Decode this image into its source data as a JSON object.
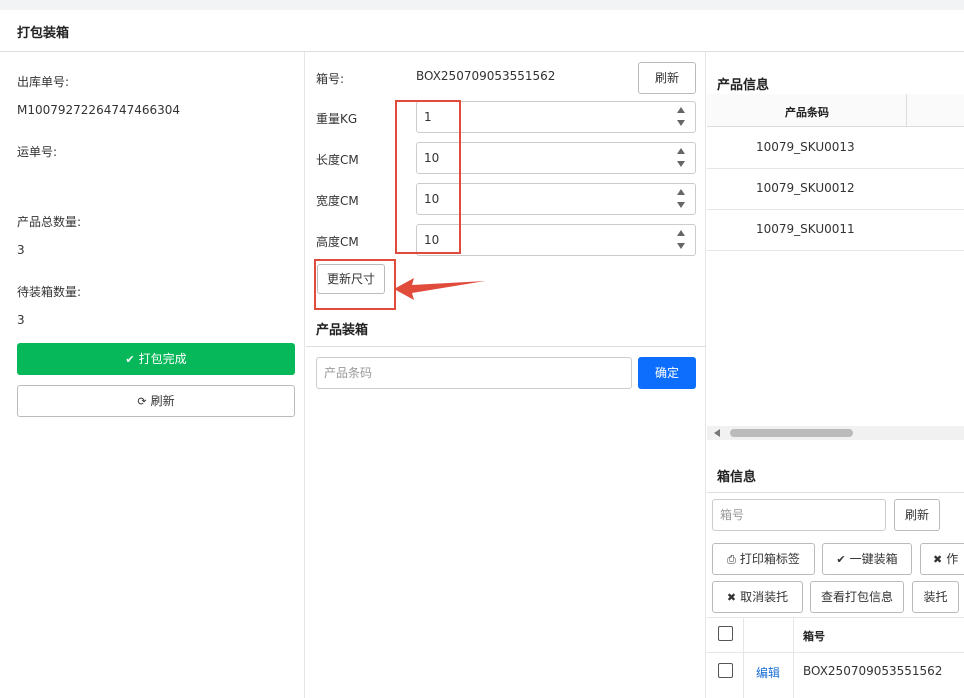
{
  "page_title": "打包装箱",
  "left": {
    "outbound_no_label": "出库单号:",
    "outbound_no_value": "M10079272264747466304",
    "waybill_label": "运单号:",
    "waybill_value": "",
    "total_qty_label": "产品总数量:",
    "total_qty_value": "3",
    "pending_qty_label": "待装箱数量:",
    "pending_qty_value": "3",
    "finish_button": "打包完成",
    "refresh_button": "刷新"
  },
  "middle": {
    "box_no_label": "箱号:",
    "box_no_value": "BOX250709053551562",
    "refresh_button": "刷新",
    "weight_label": "重量KG",
    "weight_value": "1",
    "length_label": "长度CM",
    "length_value": "10",
    "width_label": "宽度CM",
    "width_value": "10",
    "height_label": "高度CM",
    "height_value": "10",
    "update_size_button": "更新尺寸",
    "section_title": "产品装箱",
    "barcode_placeholder": "产品条码",
    "confirm_button": "确定"
  },
  "right": {
    "product_info_title": "产品信息",
    "product_table_header": "产品条码",
    "product_rows": [
      "10079_SKU0013",
      "10079_SKU0012",
      "10079_SKU0011"
    ],
    "box_info_title": "箱信息",
    "box_no_placeholder": "箱号",
    "refresh_button": "刷新",
    "print_label_button": "打印箱标签",
    "one_click_box_button": "一键装箱",
    "void_button_partial": "作",
    "cancel_pallet_button": "取消装托",
    "view_pack_info_button": "查看打包信息",
    "pallet_button": "装托",
    "box_table_header": "箱号",
    "box_row_action": "编辑",
    "box_row_value": "BOX250709053551562"
  },
  "colors": {
    "success": "#07b85a",
    "primary": "#0d6efd",
    "annotation": "#e04b3c",
    "link": "#1a6fd6"
  },
  "icons": {
    "finish": "check-icon",
    "refresh": "refresh-icon",
    "print": "printer-icon",
    "one_click": "check-icon",
    "close": "close-icon"
  }
}
